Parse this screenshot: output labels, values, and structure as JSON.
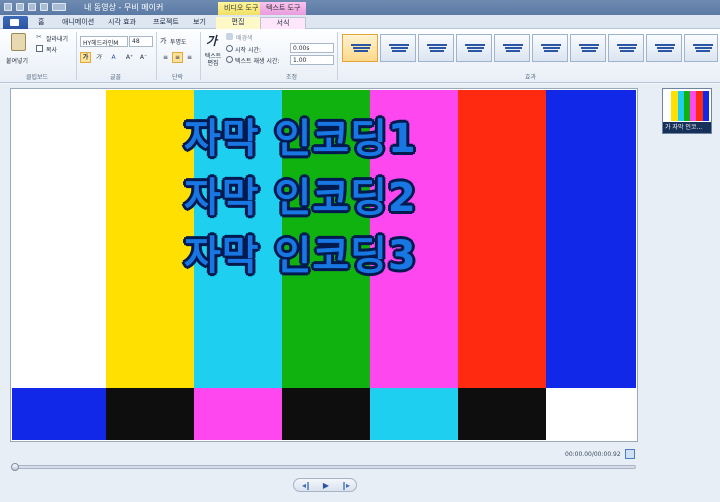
{
  "window": {
    "title": "내 동영상 - 무비 메이커",
    "context_video": "비디오 도구",
    "context_text": "텍스트 도구"
  },
  "tabs": [
    "홈",
    "애니메이션",
    "시각 효과",
    "프로젝트",
    "보기",
    "편집",
    "서식"
  ],
  "ribbon": {
    "clipboard": {
      "paste": "붙여넣기",
      "cut": "잘라내기",
      "copy": "복사",
      "label": "클립보드"
    },
    "font": {
      "family": "HY헤드라인M",
      "size": "48",
      "label": "글꼴"
    },
    "paragraph": {
      "transparency": "투명도",
      "label": "단락"
    },
    "adjust": {
      "text_edit": "텍스트 편집",
      "background": "배경색",
      "start_time": "시작 시간:",
      "start_value": "0.00s",
      "duration": "텍스트 재생 시간:",
      "duration_value": "1.00",
      "label": "조정"
    },
    "effects": {
      "label": "효과",
      "count": 10,
      "selected": 0
    }
  },
  "preview": {
    "captions": [
      "자막 인코딩1",
      "자막 인코딩2",
      "자막 인코딩3"
    ],
    "top_colors": [
      "#ffffff",
      "#ffe000",
      "#1ecff0",
      "#10b210",
      "#ff47f0",
      "#ff2a10",
      "#1228e8"
    ],
    "bottom_colors": [
      "#1228e8",
      "#0e0e0e",
      "#ff47f0",
      "#0e0e0e",
      "#1ecff0",
      "#0e0e0e",
      "#ffffff"
    ]
  },
  "playback": {
    "timecode": "00:00.00/00:00.92",
    "progress": 0.0
  },
  "storyboard": {
    "clip_caption": "가 자막 인코..."
  }
}
